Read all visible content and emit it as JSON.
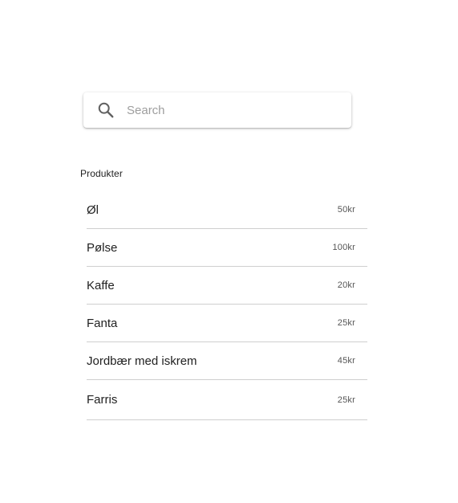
{
  "search": {
    "placeholder": "Search",
    "value": "",
    "icon": "search-icon"
  },
  "products": {
    "heading": "Produkter",
    "items": [
      {
        "name": "Øl",
        "price": "50kr"
      },
      {
        "name": "Pølse",
        "price": "100kr"
      },
      {
        "name": "Kaffe",
        "price": "20kr"
      },
      {
        "name": "Fanta",
        "price": "25kr"
      },
      {
        "name": "Jordbær med iskrem",
        "price": "45kr"
      },
      {
        "name": "Farris",
        "price": "25kr"
      }
    ]
  },
  "colors": {
    "text": "#212121",
    "placeholder": "#9e9e9e",
    "divider": "#cfcfcf",
    "icon": "#616161"
  }
}
